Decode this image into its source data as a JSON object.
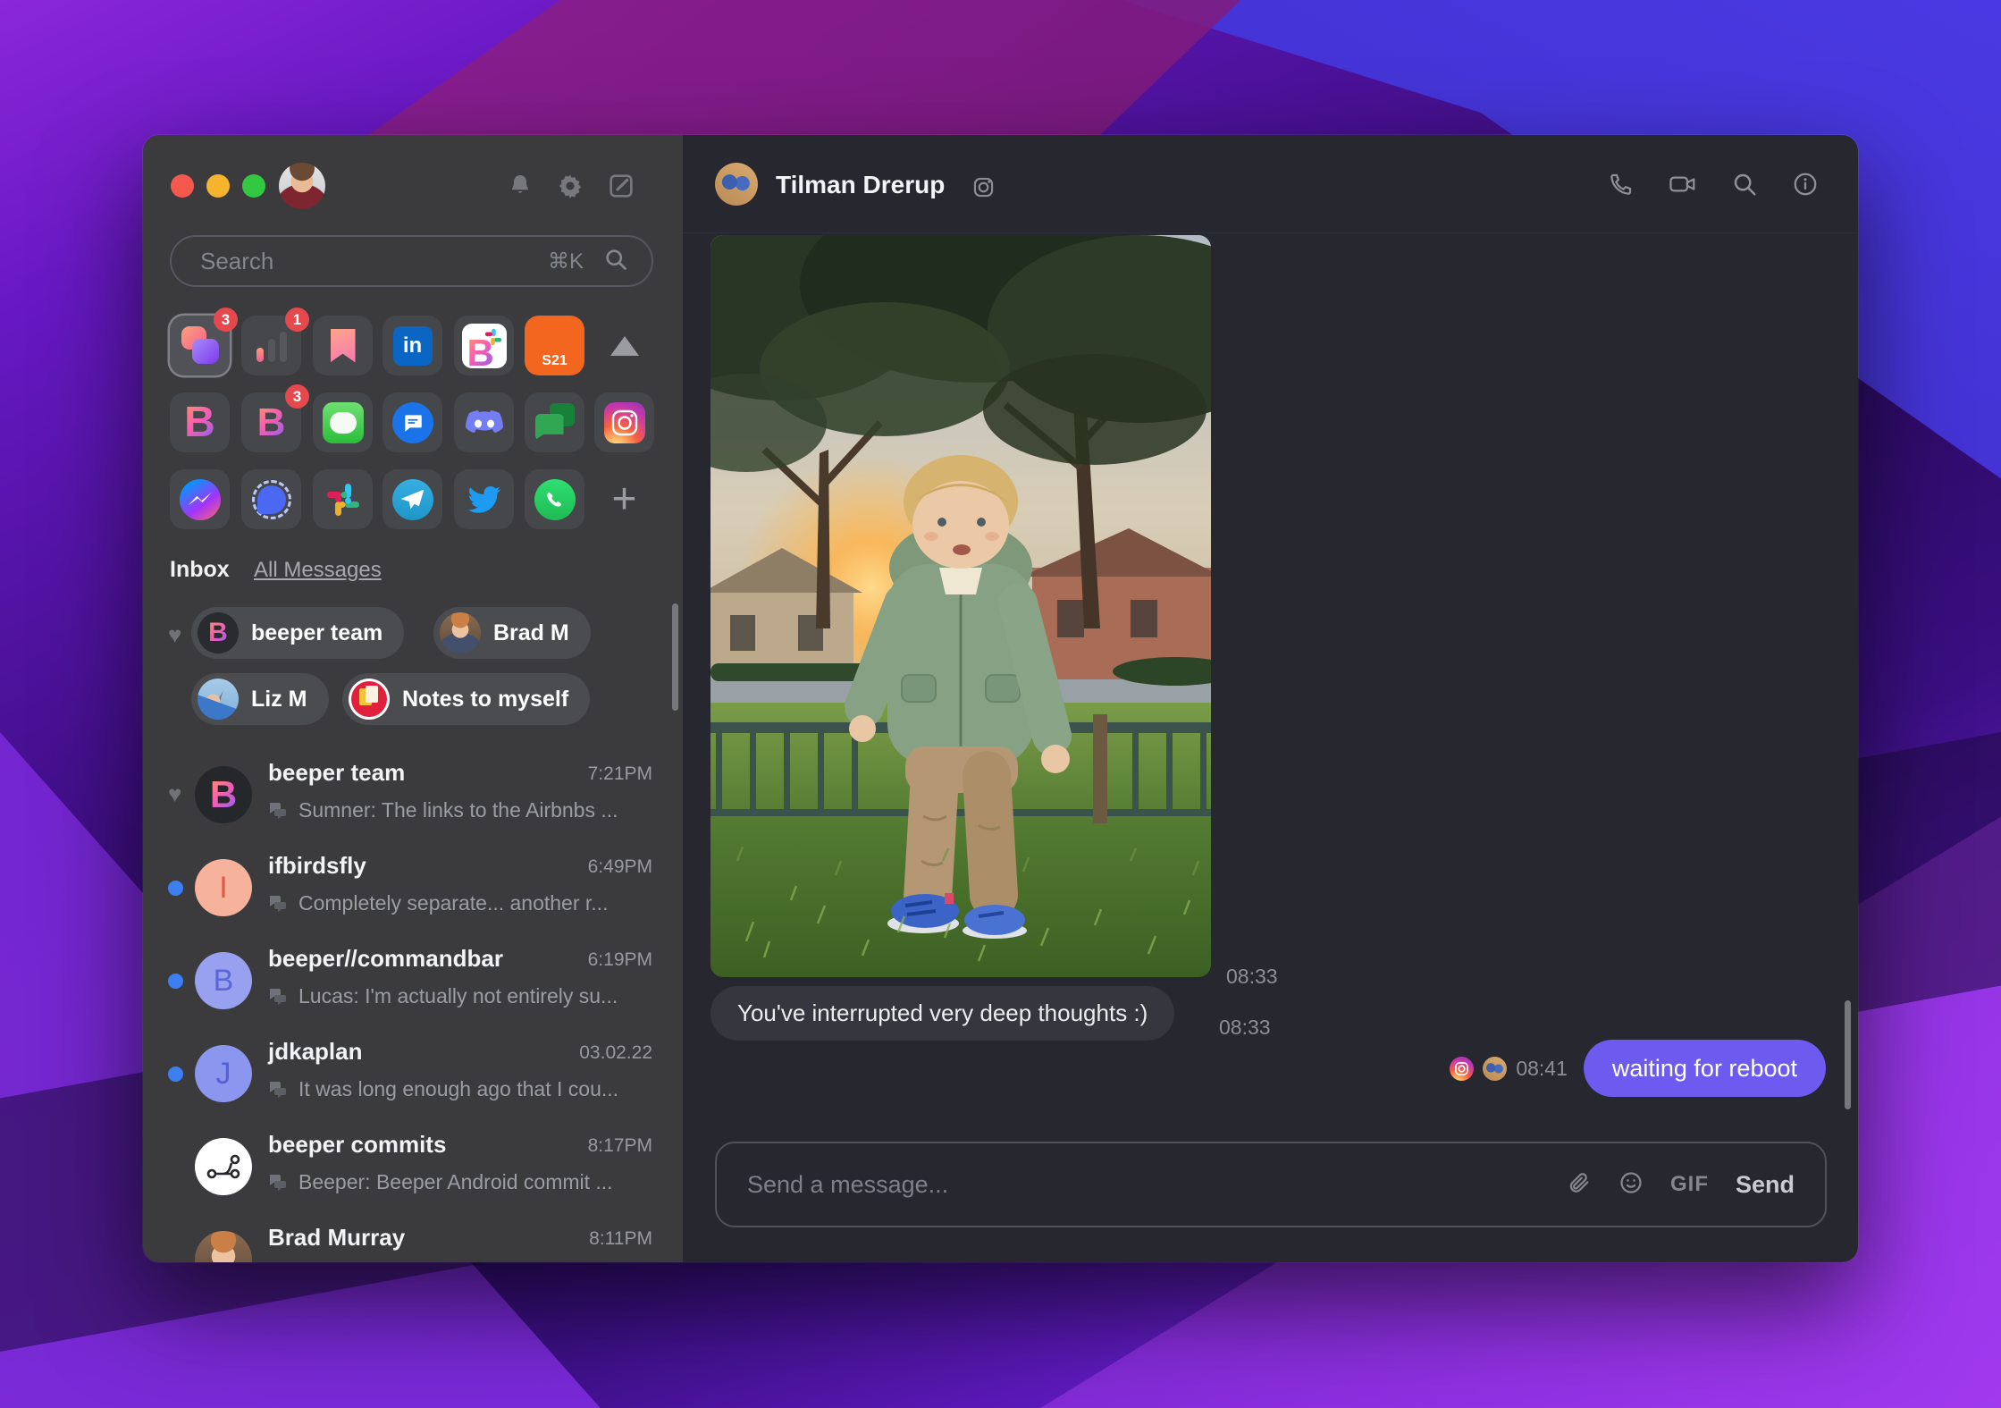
{
  "window": {
    "app": "Beeper"
  },
  "sidebar": {
    "search": {
      "placeholder": "Search",
      "shortcut": "⌘K"
    },
    "networks": {
      "row1": [
        {
          "name": "beeper-chats",
          "badge": "3"
        },
        {
          "name": "low-priority",
          "badge": "1"
        },
        {
          "name": "bookmarks"
        },
        {
          "name": "linkedin",
          "label": "in"
        },
        {
          "name": "beeper-slack"
        },
        {
          "name": "s21",
          "label": "S21"
        }
      ],
      "row2": [
        {
          "name": "beeper"
        },
        {
          "name": "beeper-unread",
          "badge": "3"
        },
        {
          "name": "imessage"
        },
        {
          "name": "sms"
        },
        {
          "name": "discord"
        },
        {
          "name": "google-chat"
        },
        {
          "name": "instagram"
        }
      ],
      "row3": [
        {
          "name": "messenger"
        },
        {
          "name": "signal"
        },
        {
          "name": "slack"
        },
        {
          "name": "telegram"
        },
        {
          "name": "twitter"
        },
        {
          "name": "whatsapp"
        }
      ]
    },
    "inbox_label": "Inbox",
    "all_messages_label": "All Messages",
    "favorites": [
      {
        "name": "beeper team"
      },
      {
        "name": "Brad M"
      },
      {
        "name": "Liz M"
      },
      {
        "name": "Notes to myself"
      }
    ],
    "chats": [
      {
        "name": "beeper team",
        "time": "7:21PM",
        "preview": "Sumner: The links to the Airbnbs ...",
        "marker": "favorite"
      },
      {
        "name": "ifbirdsfly",
        "time": "6:49PM",
        "preview": "Completely separate... another r...",
        "marker": "unread",
        "initial": "I"
      },
      {
        "name": "beeper//commandbar",
        "time": "6:19PM",
        "preview": "Lucas: I'm actually not entirely su...",
        "marker": "unread",
        "initial": "B"
      },
      {
        "name": "jdkaplan",
        "time": "03.02.22",
        "preview": "It was long enough ago that I cou...",
        "marker": "unread",
        "initial": "J"
      },
      {
        "name": "beeper commits",
        "time": "8:17PM",
        "preview": "Beeper: Beeper Android commit ...",
        "marker": "none"
      },
      {
        "name": "Brad Murray",
        "time": "8:11PM",
        "preview": "",
        "marker": "none"
      }
    ]
  },
  "main": {
    "header": {
      "name": "Tilman Drerup",
      "network": "instagram"
    },
    "messages": {
      "photo_time": "08:33",
      "incoming_text": "You've interrupted very deep thoughts :)",
      "incoming_time": "08:33",
      "outgoing_text": "waiting for reboot",
      "outgoing_time": "08:41"
    },
    "composer": {
      "placeholder": "Send a message...",
      "gif_label": "GIF",
      "send_label": "Send"
    }
  }
}
